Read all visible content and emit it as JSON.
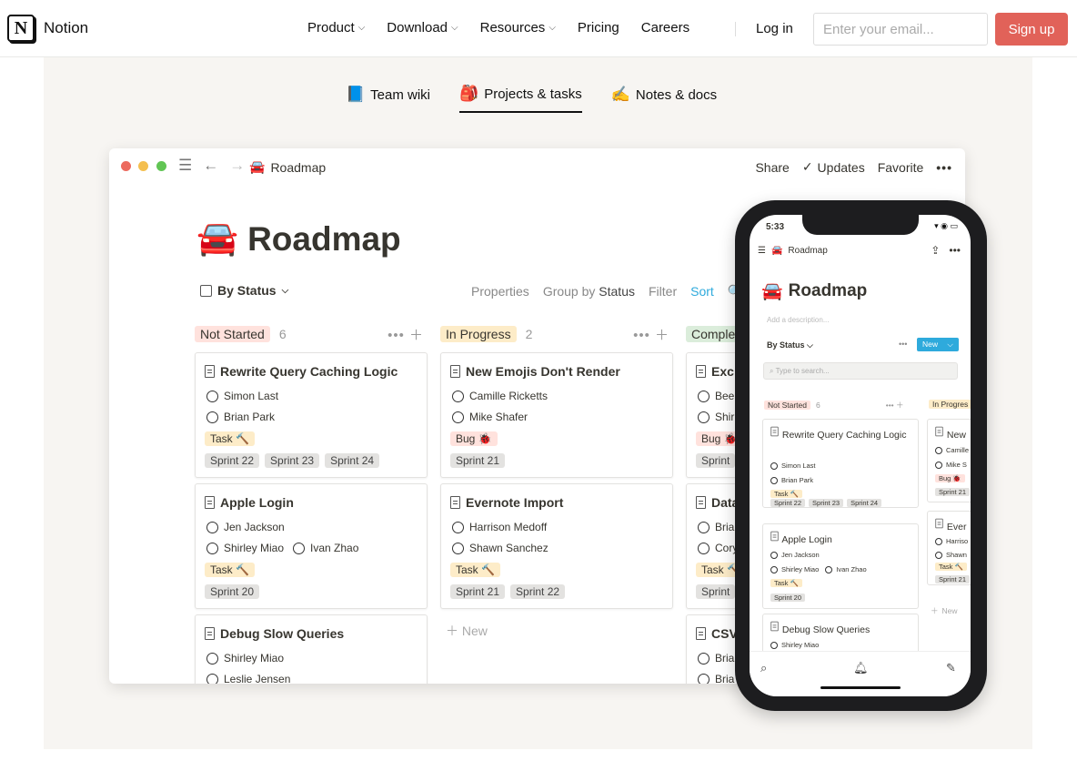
{
  "nav": {
    "brand": "Notion",
    "logo_letter": "N",
    "links": [
      {
        "label": "Product",
        "dropdown": true
      },
      {
        "label": "Download",
        "dropdown": true
      },
      {
        "label": "Resources",
        "dropdown": true
      },
      {
        "label": "Pricing",
        "dropdown": false
      },
      {
        "label": "Careers",
        "dropdown": false
      }
    ],
    "login": "Log in",
    "email_placeholder": "Enter your email...",
    "signup": "Sign up"
  },
  "feature_tabs": [
    {
      "icon": "📘",
      "label": "Team wiki",
      "active": false
    },
    {
      "icon": "🎒",
      "label": "Projects & tasks",
      "active": true
    },
    {
      "icon": "✍️",
      "label": "Notes & docs",
      "active": false
    }
  ],
  "window": {
    "breadcrumb": "Roadmap",
    "breadcrumb_icon": "🚘",
    "actions": {
      "share": "Share",
      "updates": "Updates",
      "favorite": "Favorite"
    },
    "page_title": "Roadmap",
    "view": "By Status",
    "options": {
      "properties": "Properties",
      "group_by": "Group by",
      "group_field": "Status",
      "filter": "Filter",
      "sort": "Sort"
    },
    "new_label": "New",
    "columns": [
      {
        "name": "Not Started",
        "count": "6",
        "cards": [
          {
            "title": "Rewrite Query Caching Logic",
            "people": [
              "Simon Last",
              "Brian Park"
            ],
            "type": "Task 🔨",
            "sprints": [
              "Sprint 22",
              "Sprint 23",
              "Sprint 24"
            ]
          },
          {
            "title": "Apple Login",
            "people": [
              "Jen Jackson",
              "Shirley Miao",
              "Ivan Zhao"
            ],
            "type": "Task 🔨",
            "sprints": [
              "Sprint 20"
            ]
          },
          {
            "title": "Debug Slow Queries",
            "people": [
              "Shirley Miao",
              "Leslie Jensen"
            ]
          }
        ]
      },
      {
        "name": "In Progress",
        "count": "2",
        "cards": [
          {
            "title": "New Emojis Don't Render",
            "people": [
              "Camille Ricketts",
              "Mike Shafer"
            ],
            "type": "Bug 🐞",
            "sprints": [
              "Sprint 21"
            ]
          },
          {
            "title": "Evernote Import",
            "people": [
              "Harrison Medoff",
              "Shawn Sanchez"
            ],
            "type": "Task 🔨",
            "sprints": [
              "Sprint 21",
              "Sprint 22"
            ]
          }
        ]
      },
      {
        "name": "Comple",
        "count": "",
        "cards": [
          {
            "title": "Exc",
            "people": [
              "Bee",
              "Shir"
            ],
            "type": "Bug 🐞",
            "sprints": [
              "Sprint"
            ]
          },
          {
            "title": "Data",
            "people": [
              "Bria",
              "Cory"
            ],
            "type": "Task 🔨",
            "sprints": [
              "Sprint"
            ]
          },
          {
            "title": "CSV",
            "people": [
              "Bria",
              "Bria"
            ]
          }
        ]
      }
    ]
  },
  "phone": {
    "time": "5:33",
    "status_icons": "▾ ◉ ▭",
    "breadcrumb": "Roadmap",
    "title": "Roadmap",
    "description_placeholder": "Add a description...",
    "view": "By Status",
    "new_btn": "New",
    "search_placeholder": "Type to search...",
    "col1": {
      "name": "Not Started",
      "count": "6"
    },
    "col2": {
      "name": "In Progres"
    },
    "cards": [
      {
        "title": "Rewrite Query Caching Logic",
        "people": [
          "Simon Last",
          "Brian Park"
        ],
        "type": "Task 🔨",
        "sprints": [
          "Sprint 22",
          "Sprint 23",
          "Sprint 24"
        ]
      },
      {
        "title": "Apple Login",
        "people": [
          "Jen Jackson",
          "Shirley Miao",
          "Ivan Zhao"
        ],
        "type": "Task 🔨",
        "sprints": [
          "Sprint 20"
        ]
      },
      {
        "title": "Debug Slow Queries",
        "people": [
          "Shirley Miao"
        ]
      }
    ],
    "cards2": [
      {
        "title": "New",
        "people": [
          "Camille",
          "Mike S"
        ],
        "type": "Bug 🐞",
        "sprints": [
          "Sprint 21"
        ]
      },
      {
        "title": "Ever",
        "people": [
          "Harriso",
          "Shawn"
        ],
        "type": "Task 🔨",
        "sprints": [
          "Sprint 21"
        ]
      }
    ],
    "new_label": "New"
  },
  "colors": {
    "accent": "#2eaadc",
    "signup": "#e16259",
    "not_started": "#ffe2dd",
    "in_progress": "#fdecc8",
    "complete": "#dbeddb",
    "bug": "#ffe2dd",
    "task": "#fdecc8"
  }
}
